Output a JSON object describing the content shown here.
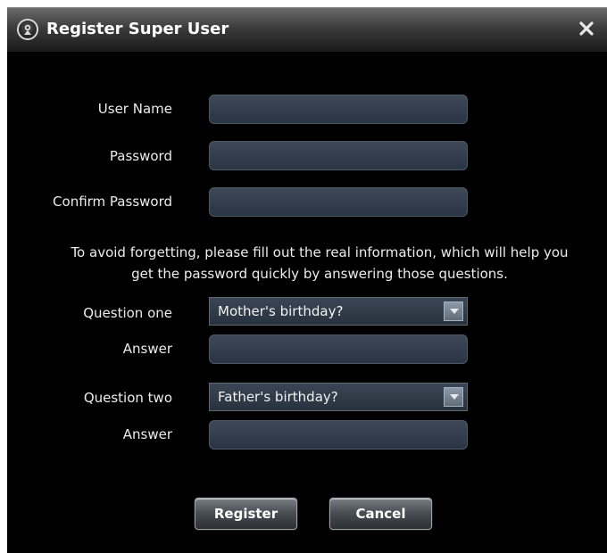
{
  "window": {
    "title": "Register Super User",
    "close_icon": "close-icon",
    "app_icon": "camera-logo-icon"
  },
  "form": {
    "user_name": {
      "label": "User Name",
      "value": ""
    },
    "password": {
      "label": "Password",
      "value": ""
    },
    "confirm_password": {
      "label": "Confirm Password",
      "value": ""
    },
    "info_line1": "To avoid forgetting, please fill out the real information, which will help you",
    "info_line2": "get the password quickly by answering those questions.",
    "question_one": {
      "label": "Question one",
      "selected": "Mother's birthday?"
    },
    "answer_one": {
      "label": "Answer",
      "value": ""
    },
    "question_two": {
      "label": "Question two",
      "selected": "Father's birthday?"
    },
    "answer_two": {
      "label": "Answer",
      "value": ""
    }
  },
  "buttons": {
    "register_label": "Register",
    "cancel_label": "Cancel"
  },
  "colors": {
    "background": "#000000",
    "input_fill": "#343f4c",
    "text": "#ececec"
  }
}
